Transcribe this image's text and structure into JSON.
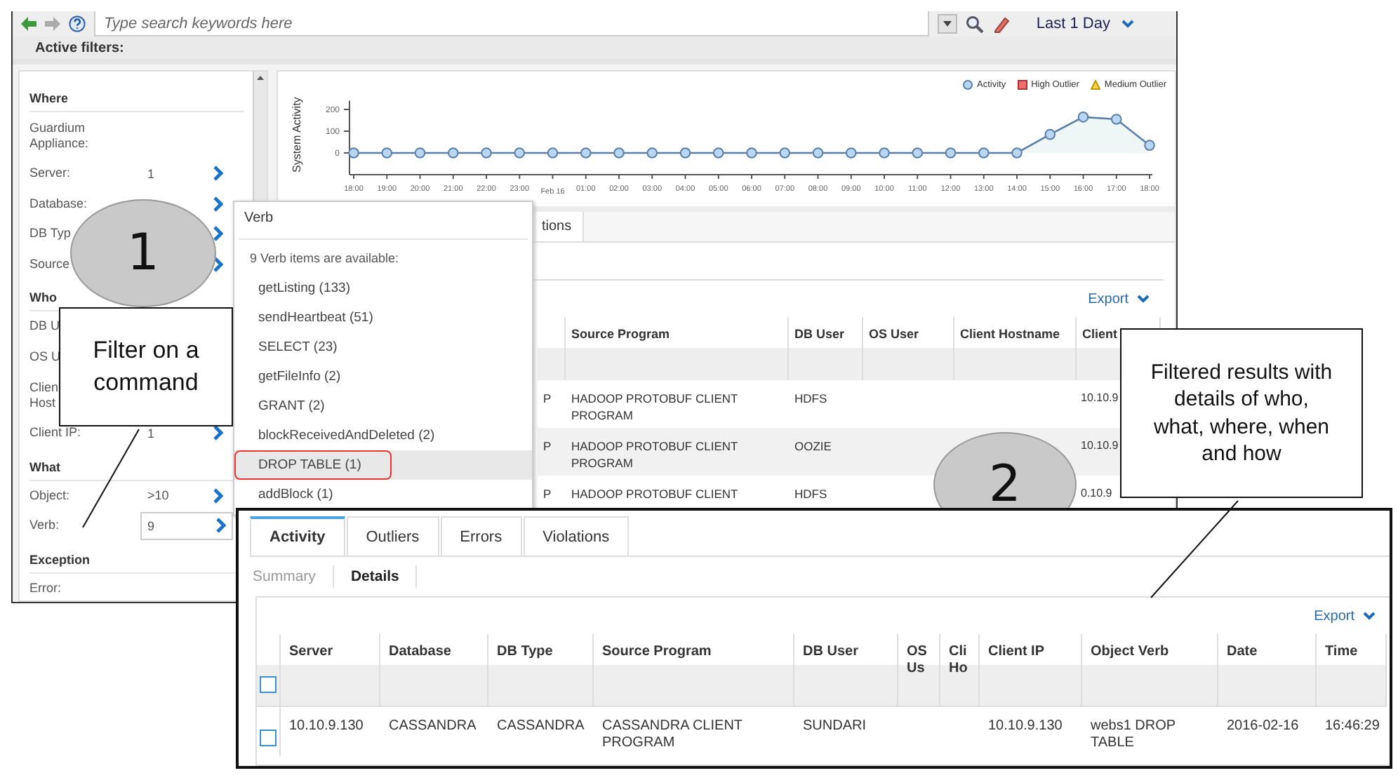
{
  "toolbar": {
    "search": {
      "placeholder": "Type search keywords here"
    },
    "time_range": "Last 1 Day"
  },
  "filters_bar": {
    "label": "Active filters:"
  },
  "filter_panel": {
    "sections": [
      {
        "heading": "Where",
        "rows": [
          {
            "label": "Guardium Appliance:",
            "kind": "text",
            "arrow": false
          },
          {
            "label": "Server:",
            "value": "1",
            "kind": "text",
            "arrow": true
          },
          {
            "label": "Database:",
            "kind": "text",
            "arrow": true
          },
          {
            "label": "DB Typ",
            "kind": "text",
            "arrow": true
          },
          {
            "label": "Source",
            "kind": "text",
            "arrow": true
          }
        ]
      },
      {
        "heading": "Who",
        "rows": [
          {
            "label": "DB U",
            "kind": "text",
            "arrow": false
          },
          {
            "label": "OS U",
            "kind": "text",
            "arrow": false
          },
          {
            "label": "Clien\nHost",
            "kind": "text",
            "arrow": false
          },
          {
            "label": "Client IP:",
            "value": "1",
            "kind": "text",
            "arrow": true
          }
        ]
      },
      {
        "heading": "What",
        "rows": [
          {
            "label": "Object:",
            "value": ">10",
            "kind": "text",
            "arrow": true
          },
          {
            "label": "Verb:",
            "value": "9",
            "kind": "field",
            "arrow": true
          }
        ]
      },
      {
        "heading": "Exception",
        "rows": [
          {
            "label": "Error:",
            "kind": "text",
            "arrow": false
          }
        ]
      }
    ]
  },
  "activity_chart": {
    "legend": [
      {
        "label": "High Outlier",
        "kind": "square",
        "color": "#f07070"
      },
      {
        "label": "Medium Outlier",
        "kind": "triangle",
        "color": "#f5d742"
      }
    ],
    "chart_data": {
      "type": "area",
      "ylabel": "System Activity",
      "categories": [
        "18:00",
        "19:00",
        "20:00",
        "21:00",
        "22:00",
        "23:00",
        "Feb 16",
        "01:00",
        "02:00",
        "03:00",
        "04:00",
        "05:00",
        "06:00",
        "07:00",
        "08:00",
        "09:00",
        "10:00",
        "11:00",
        "12:00",
        "13:00",
        "14:00",
        "15:00",
        "16:00",
        "17:00",
        "18:00"
      ],
      "series": [
        {
          "name": "Activity",
          "color": "#5a7fa8",
          "values": [
            0,
            0,
            0,
            0,
            0,
            0,
            0,
            0,
            0,
            0,
            0,
            0,
            0,
            0,
            0,
            0,
            0,
            0,
            0,
            0,
            0,
            85,
            165,
            155,
            35
          ]
        }
      ],
      "ylim": [
        -100,
        240
      ],
      "yticks": [
        0,
        100,
        200
      ]
    }
  },
  "middle_results": {
    "tab_fragment": "tions",
    "export": "Export",
    "columns": [
      "Source Program",
      "DB User",
      "OS User",
      "Client Hostname",
      "Client"
    ],
    "rows": [
      {
        "column_1": "P",
        "source_program": "HADOOP PROTOBUF CLIENT PROGRAM",
        "db_user": "HDFS",
        "client_ip": "10.10.9"
      },
      {
        "column_1": "P",
        "source_program": "HADOOP PROTOBUF CLIENT PROGRAM",
        "db_user": "OOZIE",
        "client_ip": "10.10.9"
      },
      {
        "column_1": "P",
        "source_program": "HADOOP PROTOBUF CLIENT",
        "db_user": "HDFS",
        "client_ip": "0.10.9"
      }
    ]
  },
  "verb_popup": {
    "title": "Verb",
    "summary": "9 Verb items are available:",
    "items": [
      {
        "label": "getListing (133)",
        "selected": false
      },
      {
        "label": "sendHeartbeat (51)",
        "selected": false
      },
      {
        "label": "SELECT (23)",
        "selected": false
      },
      {
        "label": "getFileInfo (2)",
        "selected": false
      },
      {
        "label": "GRANT (2)",
        "selected": false
      },
      {
        "label": "blockReceivedAndDeleted (2)",
        "selected": false
      },
      {
        "label": "DROP TABLE (1)",
        "selected": true
      },
      {
        "label": "addBlock (1)",
        "selected": false
      }
    ]
  },
  "results_window": {
    "tabs": [
      {
        "label": "Activity",
        "selected": true
      },
      {
        "label": "Outliers",
        "selected": false
      },
      {
        "label": "Errors",
        "selected": false
      },
      {
        "label": "Violations",
        "selected": false
      }
    ],
    "subtabs": [
      {
        "label": "Summary",
        "selected": false
      },
      {
        "label": "Details",
        "selected": true
      }
    ],
    "export": "Export",
    "columns": [
      "Server",
      "Database",
      "DB Type",
      "Source Program",
      "DB User",
      "OS Us",
      "Cli Ho",
      "Client IP",
      "Object Verb",
      "Date",
      "Time"
    ],
    "header_checked": false,
    "rows": [
      {
        "checked": false,
        "cells": [
          "10.10.9.130",
          "CASSANDRA",
          "CASSANDRA",
          "CASSANDRA CLIENT PROGRAM",
          "SUNDARI",
          "",
          "",
          "10.10.9.130",
          "webs1 DROP TABLE",
          "2016-02-16",
          "16:46:29"
        ]
      }
    ]
  },
  "callouts": [
    {
      "number": "1",
      "text": "Filter on a command"
    },
    {
      "number": "2",
      "text": "Filtered results with details of who, what, where, when and how"
    }
  ]
}
